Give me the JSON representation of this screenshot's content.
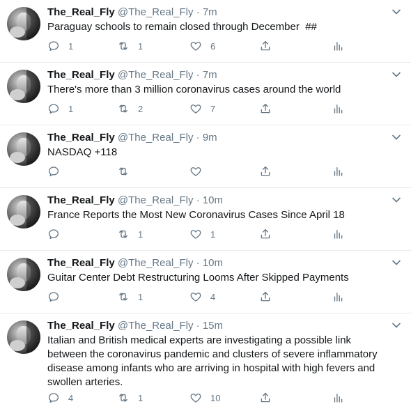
{
  "tweets": [
    {
      "name": "The_Real_Fly",
      "handle": "@The_Real_Fly",
      "dot": "·",
      "time": "7m",
      "text": "Paraguay schools to remain closed through December  ##",
      "replies": "1",
      "retweets": "1",
      "likes": "6"
    },
    {
      "name": "The_Real_Fly",
      "handle": "@The_Real_Fly",
      "dot": "·",
      "time": "7m",
      "text": "There's more than 3 million coronavirus cases around the world",
      "replies": "1",
      "retweets": "2",
      "likes": "7"
    },
    {
      "name": "The_Real_Fly",
      "handle": "@The_Real_Fly",
      "dot": "·",
      "time": "9m",
      "text": "NASDAQ +118",
      "replies": "",
      "retweets": "",
      "likes": ""
    },
    {
      "name": "The_Real_Fly",
      "handle": "@The_Real_Fly",
      "dot": "·",
      "time": "10m",
      "text": "France Reports the Most New Coronavirus Cases Since April 18",
      "replies": "",
      "retweets": "1",
      "likes": "1"
    },
    {
      "name": "The_Real_Fly",
      "handle": "@The_Real_Fly",
      "dot": "·",
      "time": "10m",
      "text": "Guitar Center Debt Restructuring Looms After Skipped Payments",
      "replies": "",
      "retweets": "1",
      "likes": "4"
    },
    {
      "name": "The_Real_Fly",
      "handle": "@The_Real_Fly",
      "dot": "·",
      "time": "15m",
      "text": "Italian and British medical experts are investigating a possible link\nbetween the coronavirus pandemic and clusters of severe inflammatory\ndisease among infants who are arriving in hospital with high fevers and\nswollen arteries.",
      "replies": "4",
      "retweets": "1",
      "likes": "10"
    }
  ],
  "icons": {
    "reply": "reply-icon",
    "retweet": "retweet-icon",
    "like": "heart-icon",
    "share": "share-icon",
    "stats": "analytics-icon",
    "caret": "chevron-down-icon"
  },
  "colors": {
    "name": "#14171a",
    "meta": "#657786",
    "divider": "#e6ecf0"
  }
}
